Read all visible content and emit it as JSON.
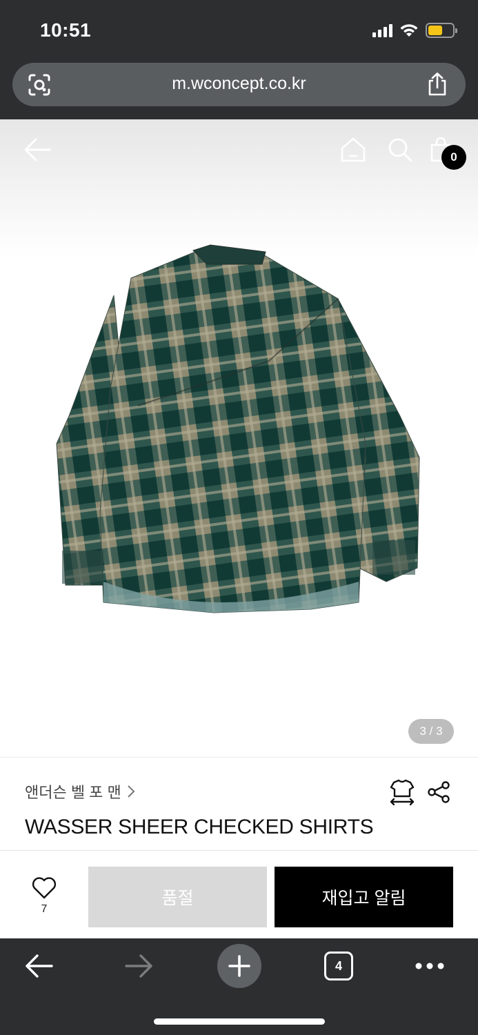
{
  "status_bar": {
    "time": "10:51"
  },
  "browser": {
    "url": "m.wconcept.co.kr",
    "open_tabs": "4"
  },
  "header": {
    "cart_count": "0"
  },
  "gallery": {
    "page_indicator": "3 / 3"
  },
  "product": {
    "brand": "앤더슨 벨 포 맨",
    "name": "WASSER SHEER CHECKED SHIRTS"
  },
  "actions": {
    "like_count": "7",
    "soldout_label": "품절",
    "restock_label": "재입고 알림"
  },
  "colors": {
    "browser_chrome": "#2c2e30",
    "url_bar": "#5a5d60",
    "soldout_button": "#d9d9d9",
    "restock_button": "#000000",
    "battery": "#f5c518"
  },
  "icons": [
    "camera-search-icon",
    "share-icon",
    "back-arrow-icon",
    "home-icon",
    "search-icon",
    "shopping-bag-icon",
    "size-guide-icon",
    "share-network-icon",
    "heart-icon",
    "plus-icon",
    "tabs-icon",
    "more-icon"
  ]
}
